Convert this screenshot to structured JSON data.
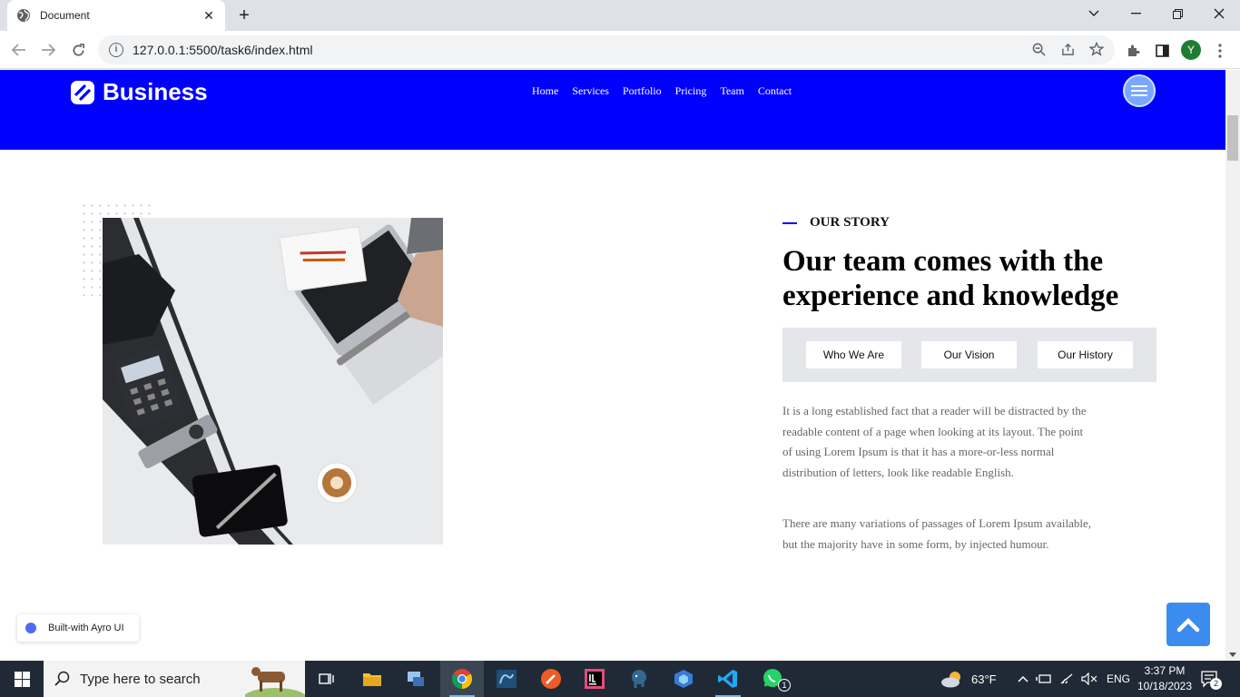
{
  "browser": {
    "tab_title": "Document",
    "url": "127.0.0.1:5500/task6/index.html",
    "profile_initial": "Y"
  },
  "site": {
    "brand": "Business",
    "nav": [
      "Home",
      "Services",
      "Portfolio",
      "Pricing",
      "Team",
      "Contact"
    ],
    "colors": {
      "header": "#0000ff",
      "accent": "#0000ff",
      "to_top": "#3c8cf0"
    }
  },
  "story": {
    "label": "OUR STORY",
    "heading_line1": "Our team comes with the",
    "heading_line2": "experience and knowledge",
    "tabs": [
      "Who We Are",
      "Our Vision",
      "Our History"
    ],
    "para1_lines": [
      "It is a long established fact that a reader will be distracted by the",
      "readable content of a page when looking at its layout. The point",
      "of using Lorem Ipsum is that it has a more-or-less normal",
      "distribution of letters, look like readable English."
    ],
    "para2_lines": [
      "There are many variations of passages of Lorem Ipsum available,",
      "but the majority have in some form, by injected humour."
    ]
  },
  "badge": {
    "text": "Built-with Ayro UI"
  },
  "taskbar": {
    "search_placeholder": "Type here to search",
    "weather": "63°F",
    "language": "ENG",
    "time": "3:37 PM",
    "date": "10/18/2023",
    "notifications": "2",
    "whatsapp_badge": "1"
  }
}
